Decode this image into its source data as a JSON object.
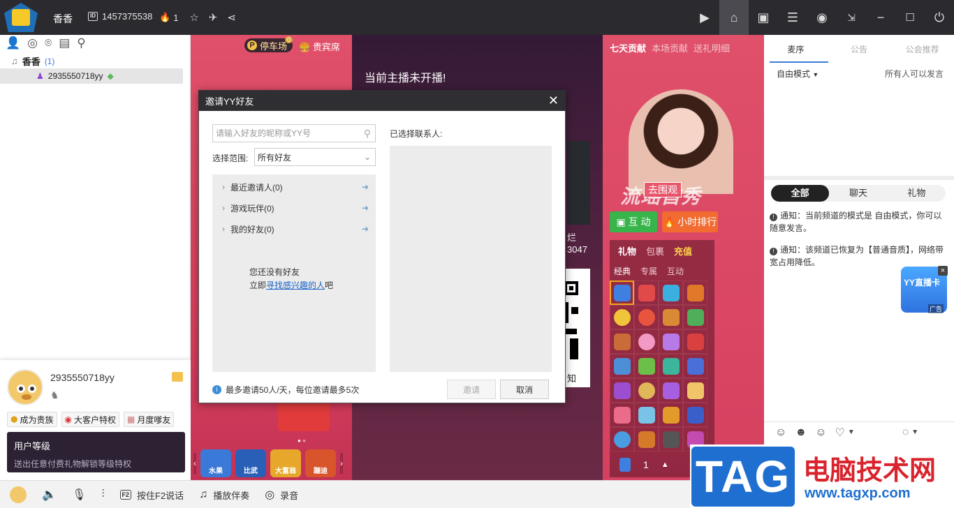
{
  "topbar": {
    "channel_name": "香香",
    "channel_id": "1457375538",
    "hot_count": "1",
    "id_badge": "ID"
  },
  "left": {
    "tree_root": "香香",
    "tree_count": "(1)",
    "tree_user": "2935550718yy",
    "profile_name": "2935550718yy",
    "badges": [
      "成为贵族",
      "大客户特权",
      "月度嗲友"
    ],
    "level_title": "用户等级",
    "level_desc": "送出任意付费礼物解锁等级特权"
  },
  "stage": {
    "parking": "停车场",
    "parking_count": "0",
    "vip": "贵宾席",
    "not_live": "当前主播未开播!",
    "contrib_tabs": [
      "七天贡献",
      "本场贡献",
      "送礼明细"
    ],
    "go_watch": "去围观",
    "promo": "流瑶首秀",
    "interact": "互 动",
    "rank": "小时排行",
    "gift_tabs": [
      "礼物",
      "包裹",
      "充值"
    ],
    "gift_subtabs": [
      "经典",
      "专属",
      "互动"
    ],
    "gift_qty": "1",
    "mid_name": "烂",
    "mid_num": "3047",
    "qr_text": "知",
    "games": [
      "水果",
      "比武",
      "大富翁",
      "蹦迪"
    ]
  },
  "right": {
    "tabs": [
      "麦序",
      "公告",
      "公会推荐"
    ],
    "mode": "自由模式",
    "mode_right": "所有人可以发言",
    "chat_tabs": [
      "全部",
      "聊天",
      "礼物"
    ],
    "notice1": "通知：当前频道的模式是 自由模式，你可以随意发言。",
    "notice2": "通知：该频道已恢复为【普通音质】，网络带宽占用降低。",
    "yy_ad": "YY直播卡",
    "yy_ad_tag": "广告"
  },
  "dialog": {
    "title": "邀请YY好友",
    "search_placeholder": "请输入好友的昵称或YY号",
    "scope_label": "选择范围:",
    "scope_value": "所有好友",
    "list": [
      "最近邀请人(0)",
      "游戏玩伴(0)",
      "我的好友(0)"
    ],
    "no_friend_line1": "您还没有好友",
    "no_friend_prefix": "立即",
    "no_friend_link": "寻找感兴趣的人",
    "no_friend_suffix": "吧",
    "selected_label": "已选择联系人:",
    "limit": "最多邀请50人/天，每位邀请最多5次",
    "invite": "邀请",
    "cancel": "取消"
  },
  "bottom": {
    "f2": "F2",
    "press_speak": "按住F2说话",
    "play_music": "播放伴奏",
    "record": "录音"
  },
  "watermark": {
    "tag": "TAG",
    "cn": "电脑技术网",
    "url": "www.tagxp.com"
  },
  "colors": {
    "accent": "#3d7bd8",
    "stage_pink": "#d64060",
    "topbar": "#2b2b2f"
  }
}
